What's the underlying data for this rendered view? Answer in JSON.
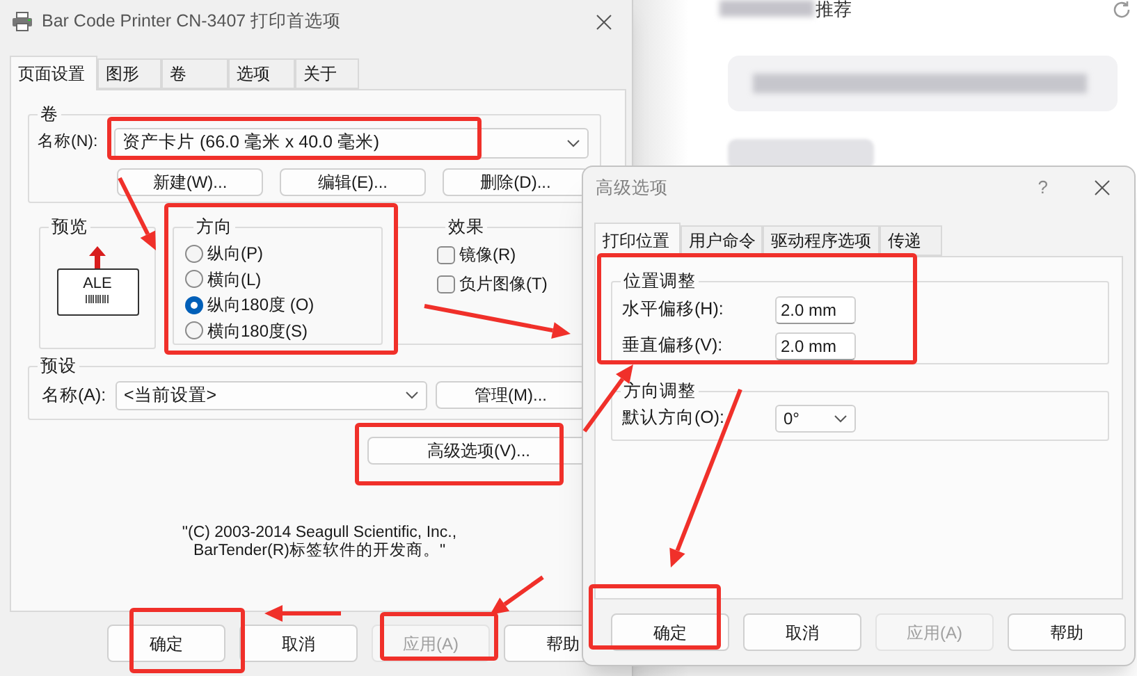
{
  "background": {
    "heading": "推荐"
  },
  "print_preferences_dialog": {
    "title": "Bar Code Printer CN-3407 打印首选项",
    "tabs": [
      {
        "label": "页面设置",
        "selected": true
      },
      {
        "label": "图形",
        "selected": false
      },
      {
        "label": "卷",
        "selected": false
      },
      {
        "label": "选项",
        "selected": false
      },
      {
        "label": "关于",
        "selected": false
      }
    ],
    "stock_group": {
      "label": "卷",
      "name_label": "名称(N):",
      "name_value": "资产卡片 (66.0 毫米 x 40.0 毫米)",
      "buttons": [
        "新建(W)...",
        "编辑(E)...",
        "删除(D)..."
      ]
    },
    "preview": {
      "label": "预览",
      "sample_text": "ALE"
    },
    "orientation": {
      "label": "方向",
      "options": [
        {
          "label": "纵向(P)",
          "selected": false
        },
        {
          "label": "横向(L)",
          "selected": false
        },
        {
          "label": "纵向180度 (O)",
          "selected": true
        },
        {
          "label": "横向180度(S)",
          "selected": false
        }
      ]
    },
    "effects": {
      "label": "效果",
      "options": [
        {
          "label": "镜像(R)",
          "checked": false
        },
        {
          "label": "负片图像(T)",
          "checked": false
        }
      ]
    },
    "preset_group": {
      "label": "预设",
      "name_label": "名称(A):",
      "name_value": "<当前设置>",
      "manage_button": "管理(M)..."
    },
    "advanced_button": "高级选项(V)...",
    "copyright": [
      "\"(C) 2003-2014 Seagull Scientific, Inc.,",
      "BarTender(R)标签软件的开发商。\""
    ],
    "buttons": [
      {
        "label": "确定",
        "disabled": false
      },
      {
        "label": "取消",
        "disabled": false
      },
      {
        "label": "应用(A)",
        "disabled": true
      },
      {
        "label": "帮助",
        "disabled": false
      }
    ]
  },
  "advanced_dialog": {
    "title": "高级选项",
    "help": "?",
    "tabs": [
      {
        "label": "打印位置",
        "selected": true
      },
      {
        "label": "用户命令",
        "selected": false
      },
      {
        "label": "驱动程序选项",
        "selected": false
      },
      {
        "label": "传递",
        "selected": false
      }
    ],
    "position_group": {
      "label": "位置调整",
      "fields": [
        {
          "label": "水平偏移(H):",
          "value": "2.0 mm"
        },
        {
          "label": "垂直偏移(V):",
          "value": "2.0 mm"
        }
      ]
    },
    "orientation_group": {
      "label": "方向调整",
      "default_label": "默认方向(O):",
      "default_value": "0°"
    },
    "buttons": [
      {
        "label": "确定",
        "disabled": false
      },
      {
        "label": "取消",
        "disabled": false
      },
      {
        "label": "应用(A)",
        "disabled": true
      },
      {
        "label": "帮助",
        "disabled": false
      }
    ]
  }
}
